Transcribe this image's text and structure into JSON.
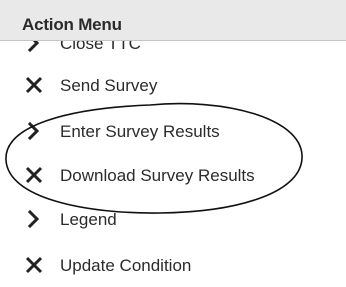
{
  "menu": {
    "title": "Action Menu",
    "items": [
      {
        "label": "Close TTC",
        "icon": "chevron-right-icon"
      },
      {
        "label": "Send Survey",
        "icon": "close-x-icon"
      },
      {
        "label": "Enter Survey Results",
        "icon": "chevron-right-icon"
      },
      {
        "label": "Download Survey Results",
        "icon": "close-x-icon"
      },
      {
        "label": "Legend",
        "icon": "chevron-right-icon"
      },
      {
        "label": "Update Condition",
        "icon": "close-x-icon"
      }
    ]
  },
  "colors": {
    "header_bg": "#e9e9e9",
    "text": "#2b2b2b",
    "annotation_stroke": "#111111"
  }
}
